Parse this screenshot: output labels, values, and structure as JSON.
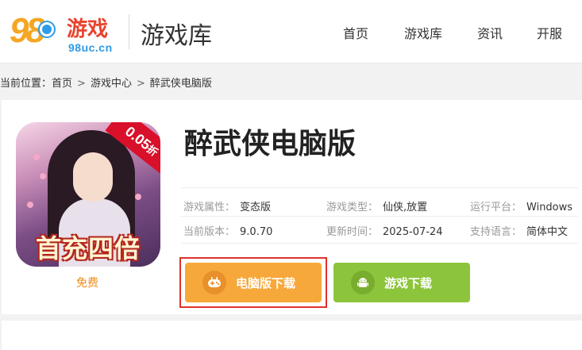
{
  "header": {
    "logo_number": "98",
    "logo_cn": "游戏",
    "logo_domain": "98uc.cn",
    "section_title": "游戏库",
    "nav": [
      "首页",
      "游戏库",
      "资讯",
      "开服"
    ]
  },
  "breadcrumb": {
    "prefix": "当前位置：",
    "items": [
      "首页",
      "游戏中心",
      "醉武侠电脑版"
    ],
    "separator": ">"
  },
  "game": {
    "title": "醉武侠电脑版",
    "icon_badge": "0.05",
    "icon_badge_unit": "折",
    "icon_text": "首充四倍",
    "price_label": "免费",
    "meta": [
      {
        "key": "游戏属性：",
        "value": "变态版"
      },
      {
        "key": "游戏类型：",
        "value": "仙侠,放置"
      },
      {
        "key": "运行平台：",
        "value": "Windows"
      },
      {
        "key": "当前版本：",
        "value": "9.0.70"
      },
      {
        "key": "更新时间：",
        "value": "2025-07-24"
      },
      {
        "key": "支持语言：",
        "value": "简体中文"
      }
    ]
  },
  "buttons": {
    "pc_download": "电脑版下载",
    "game_download": "游戏下载"
  },
  "colors": {
    "accent_orange": "#f7a83a",
    "accent_green": "#8cc43c",
    "highlight_red": "#e0322c",
    "price_orange": "#f08b1b"
  }
}
